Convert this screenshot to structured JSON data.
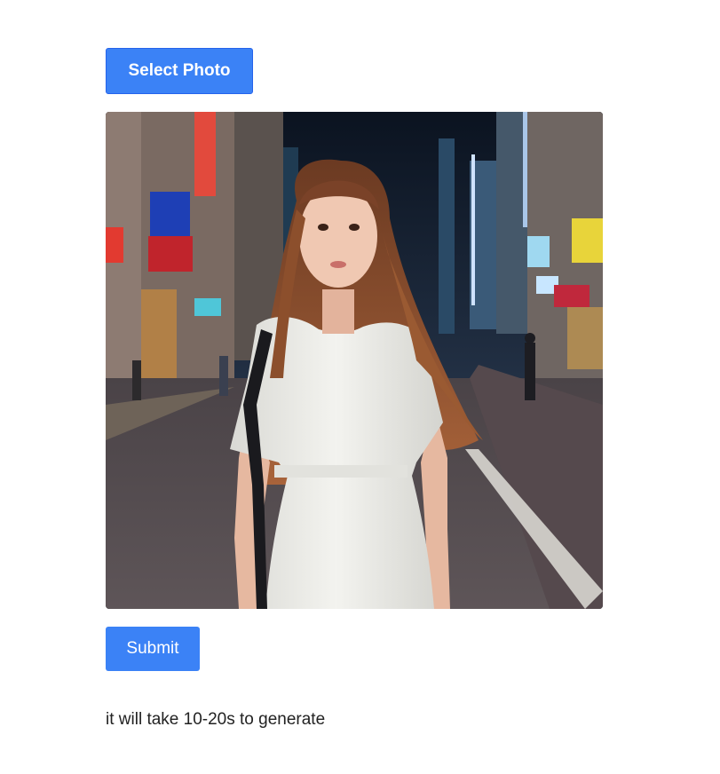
{
  "select_button": {
    "label": "Select Photo"
  },
  "photo": {
    "alt": "Woman in white dress with long brown hair standing on a neon-lit city street at night"
  },
  "submit_button": {
    "label": "Submit"
  },
  "note": {
    "text": "it will take 10-20s to generate"
  },
  "colors": {
    "accent": "#3b82f6",
    "accent_border": "#2563eb"
  }
}
